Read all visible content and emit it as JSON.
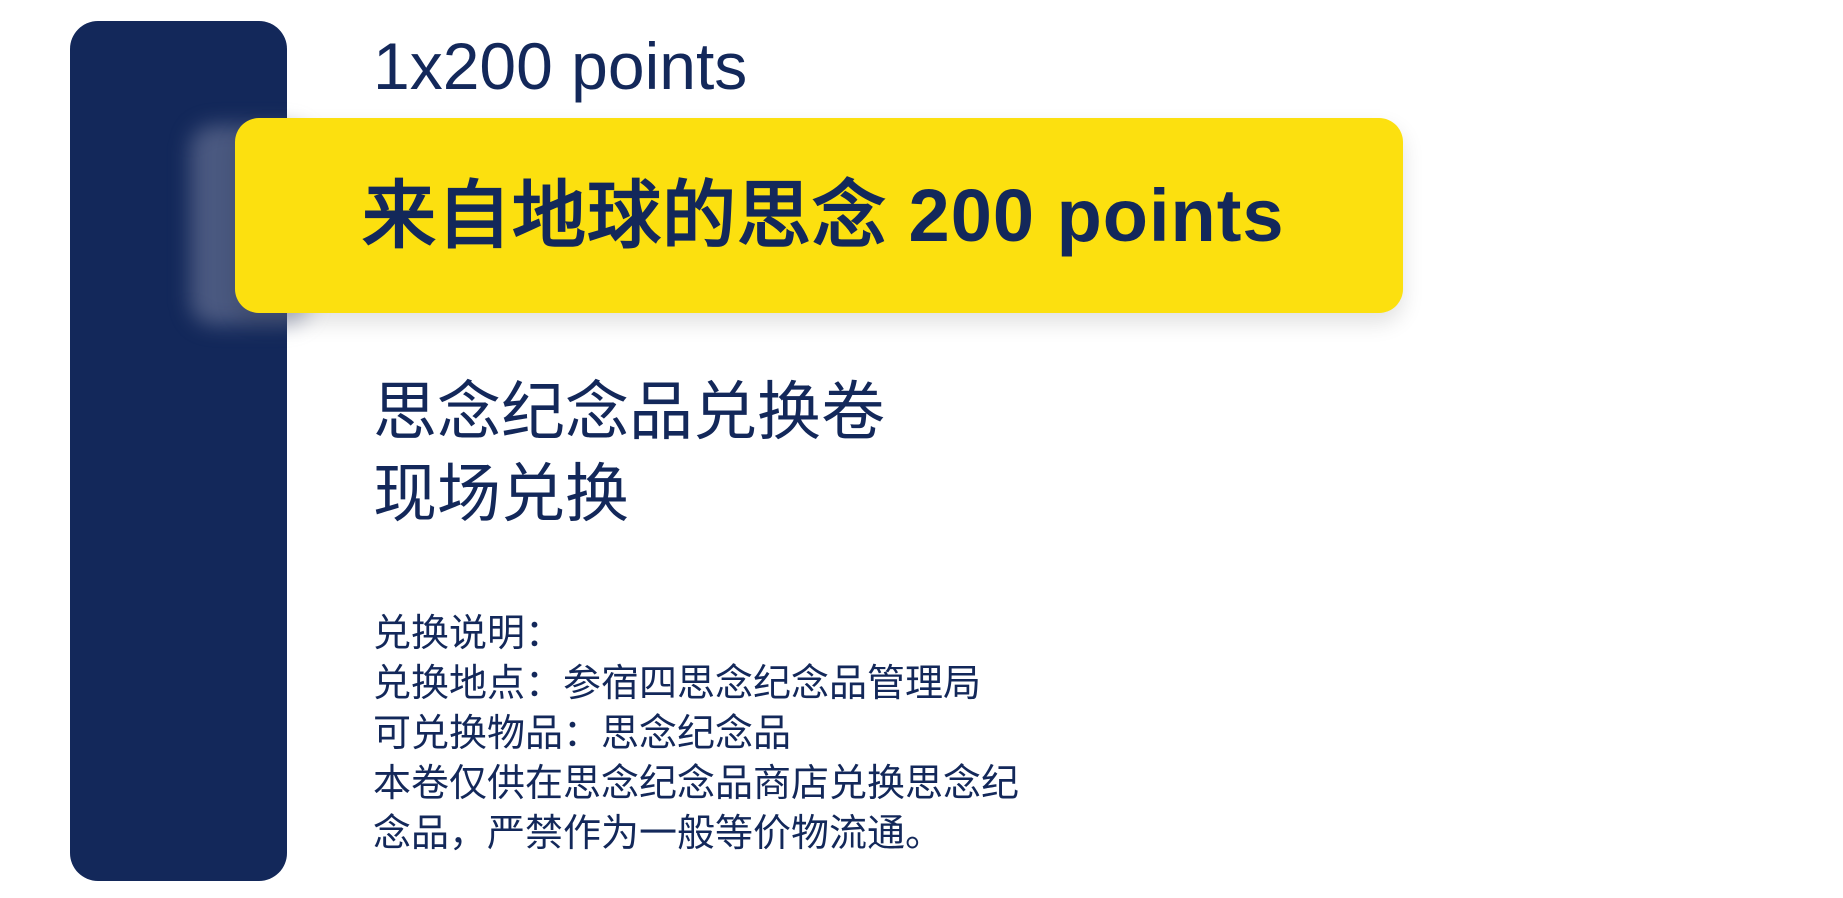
{
  "card": {
    "count_text": "1x200 points",
    "banner_title": "来自地球的思念 200 points",
    "heading_lines": [
      "思念纪念品兑换卷",
      "现场兑换"
    ],
    "notes_title": "兑换说明：",
    "notes_lines": [
      "兑换地点：参宿四思念纪念品管理局",
      "可兑换物品：思念纪念品",
      "本卷仅供在思念纪念品商店兑换思念纪",
      "念品，严禁作为一般等价物流通。"
    ]
  },
  "colors": {
    "navy": "#13285a",
    "yellow": "#fce00f",
    "background": "#ffffff"
  }
}
